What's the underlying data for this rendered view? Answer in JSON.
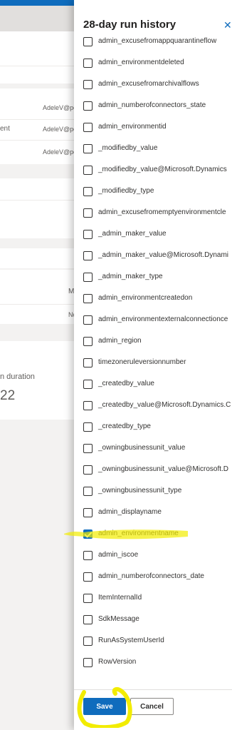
{
  "background": {
    "rows": [
      {
        "text": "",
        "email": "AdeleV@pc"
      },
      {
        "text": "ent",
        "email": "AdeleV@pc"
      },
      {
        "text": "",
        "email": "AdeleV@pc"
      }
    ],
    "mid_letters": [
      {
        "text": "M"
      },
      {
        "text": "Nc"
      }
    ],
    "duration_label": "n duration",
    "duration_value": "22"
  },
  "panel": {
    "title": "28-day run history",
    "close_glyph": "✕",
    "options": [
      {
        "label": "admin_excusefromappquarantineflow",
        "checked": false
      },
      {
        "label": "admin_environmentdeleted",
        "checked": false
      },
      {
        "label": "admin_excusefromarchivalflows",
        "checked": false
      },
      {
        "label": "admin_numberofconnectors_state",
        "checked": false
      },
      {
        "label": "admin_environmentid",
        "checked": false
      },
      {
        "label": "_modifiedby_value",
        "checked": false
      },
      {
        "label": "_modifiedby_value@Microsoft.Dynamics",
        "checked": false
      },
      {
        "label": "_modifiedby_type",
        "checked": false
      },
      {
        "label": "admin_excusefromemptyenvironmentcle",
        "checked": false
      },
      {
        "label": "_admin_maker_value",
        "checked": false
      },
      {
        "label": "_admin_maker_value@Microsoft.Dynami",
        "checked": false
      },
      {
        "label": "_admin_maker_type",
        "checked": false
      },
      {
        "label": "admin_environmentcreatedon",
        "checked": false
      },
      {
        "label": "admin_environmentexternalconnectionce",
        "checked": false
      },
      {
        "label": "admin_region",
        "checked": false
      },
      {
        "label": "timezoneruleversionnumber",
        "checked": false
      },
      {
        "label": "_createdby_value",
        "checked": false
      },
      {
        "label": "_createdby_value@Microsoft.Dynamics.C",
        "checked": false
      },
      {
        "label": "_createdby_type",
        "checked": false
      },
      {
        "label": "_owningbusinessunit_value",
        "checked": false
      },
      {
        "label": "_owningbusinessunit_value@Microsoft.D",
        "checked": false
      },
      {
        "label": "_owningbusinessunit_type",
        "checked": false
      },
      {
        "label": "admin_displayname",
        "checked": false
      },
      {
        "label": "admin_environmentname",
        "checked": true
      },
      {
        "label": "admin_iscoe",
        "checked": false
      },
      {
        "label": "admin_numberofconnectors_date",
        "checked": false
      },
      {
        "label": "ItemInternalId",
        "checked": false
      },
      {
        "label": "SdkMessage",
        "checked": false
      },
      {
        "label": "RunAsSystemUserId",
        "checked": false
      },
      {
        "label": "RowVersion",
        "checked": false
      }
    ],
    "save_label": "Save",
    "cancel_label": "Cancel"
  },
  "colors": {
    "accent": "#0f6cbd",
    "highlighter": "#f2ec00"
  }
}
